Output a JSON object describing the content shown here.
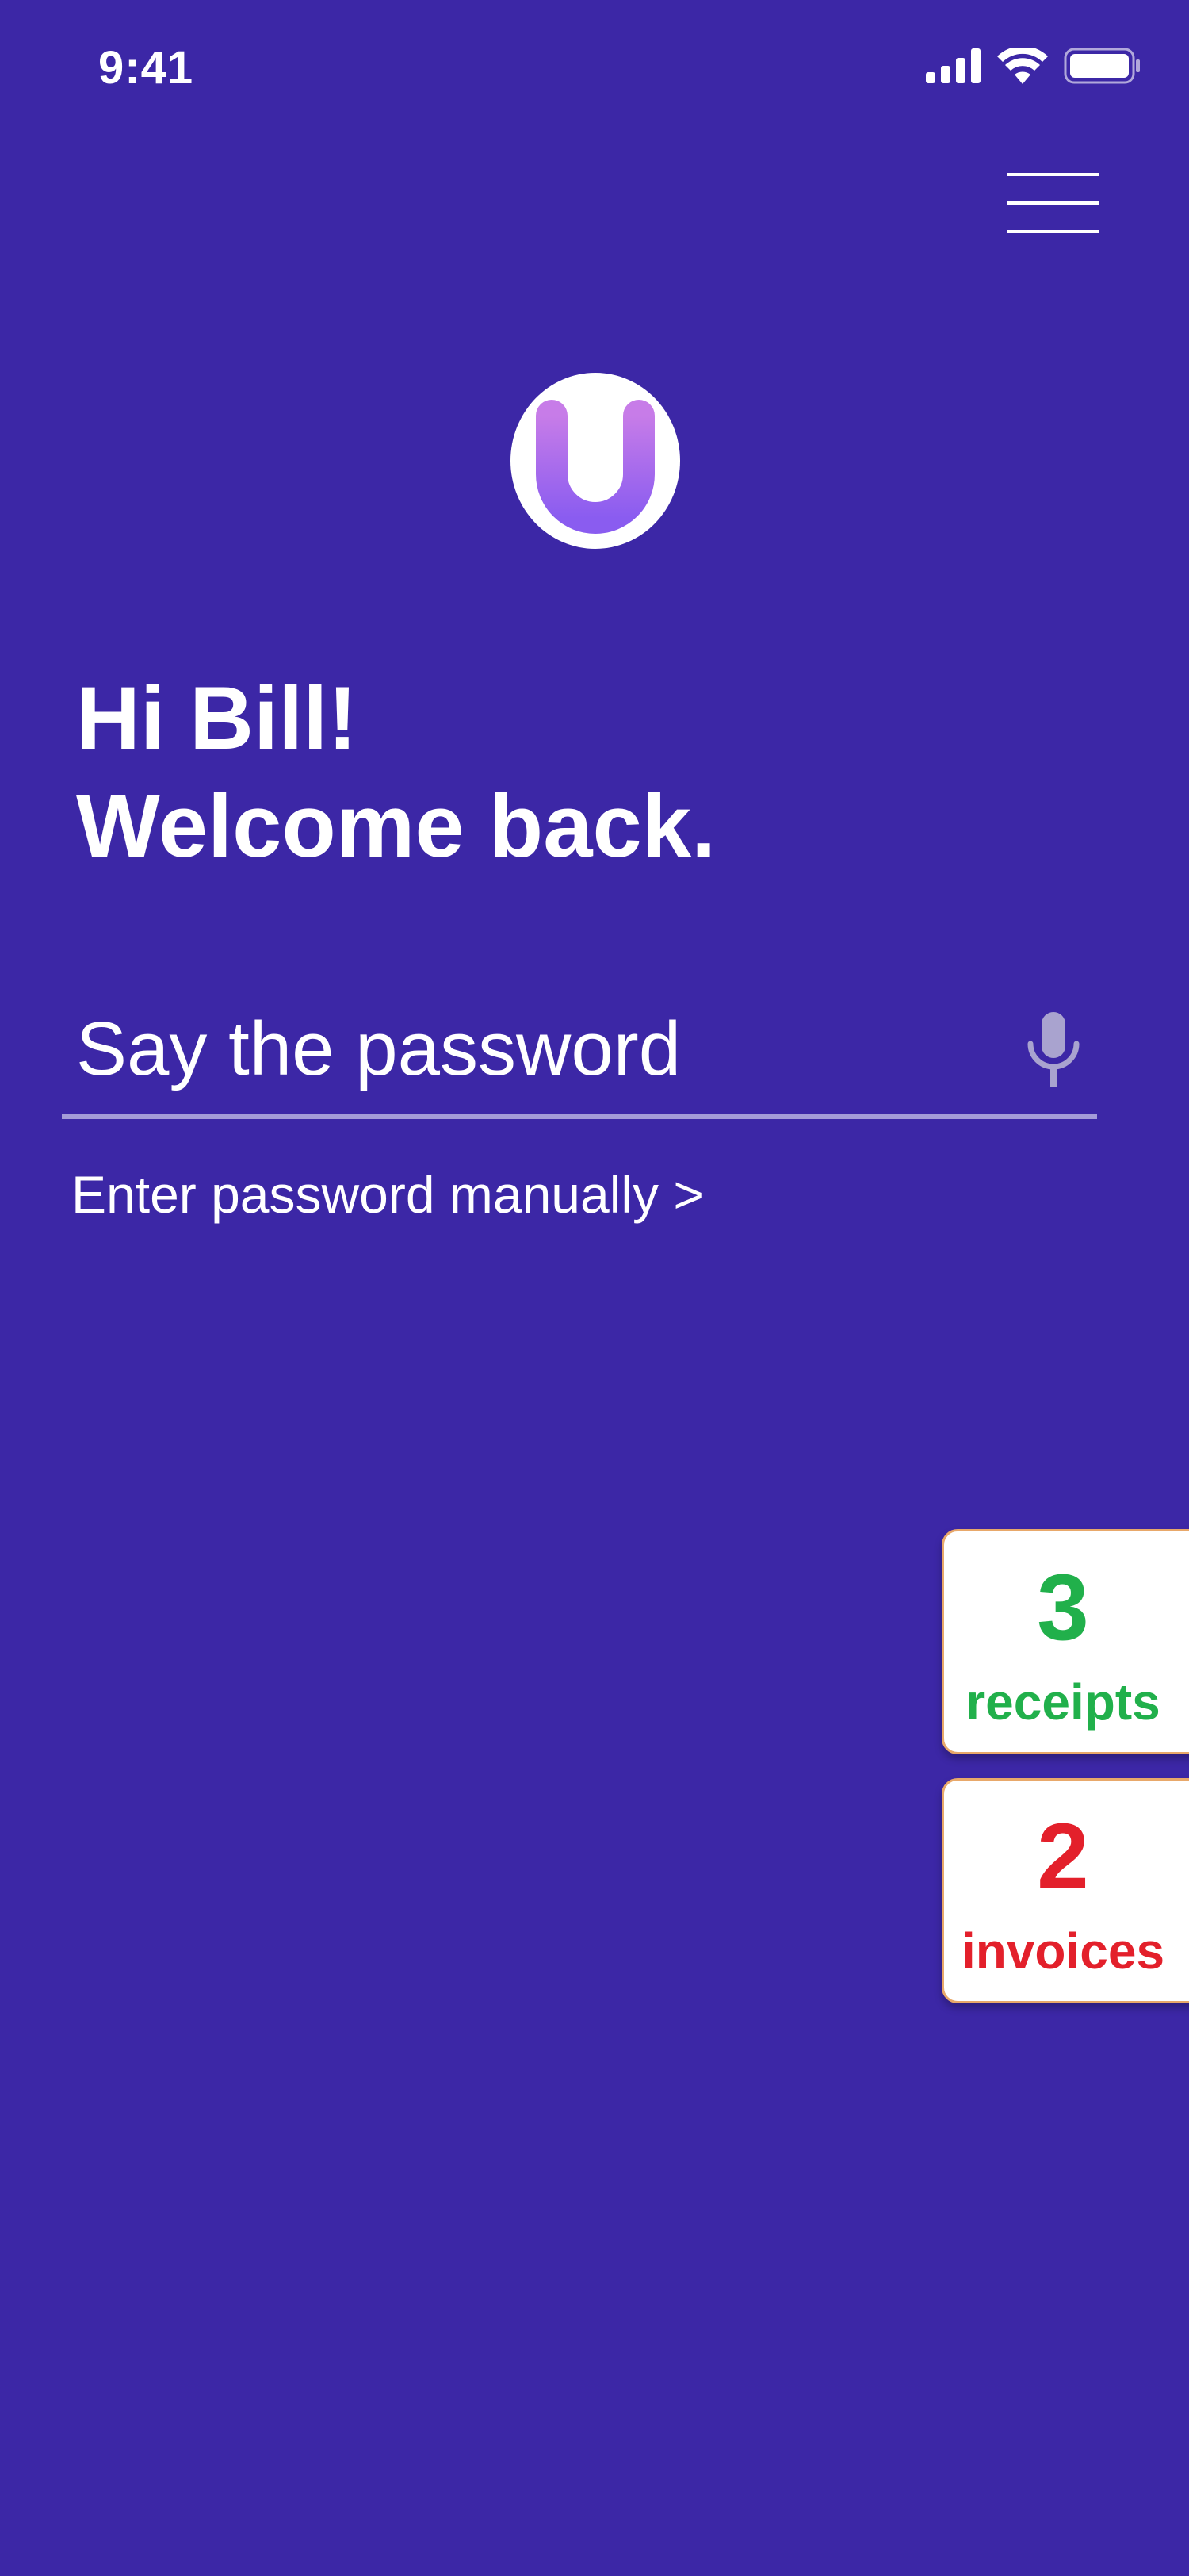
{
  "status_bar": {
    "time": "9:41",
    "icons": [
      "cellular-signal-icon",
      "wifi-icon",
      "battery-icon"
    ]
  },
  "header": {
    "menu_icon": "hamburger-menu-icon"
  },
  "logo": {
    "icon": "upload-u-arrow-logo"
  },
  "greeting": {
    "line1": "Hi Bill!",
    "line2": "Welcome back."
  },
  "password": {
    "placeholder": "Say the password",
    "mic_icon": "microphone-icon",
    "manual_link": "Enter password manually >"
  },
  "side_cards": {
    "receipts": {
      "count": "3",
      "label": "receipts",
      "color": "#21b04b"
    },
    "invoices": {
      "count": "2",
      "label": "invoices",
      "color": "#e3202b"
    }
  },
  "colors": {
    "background": "#3c27a6",
    "underline": "#a49bd8",
    "card_border": "#e8a86a"
  }
}
